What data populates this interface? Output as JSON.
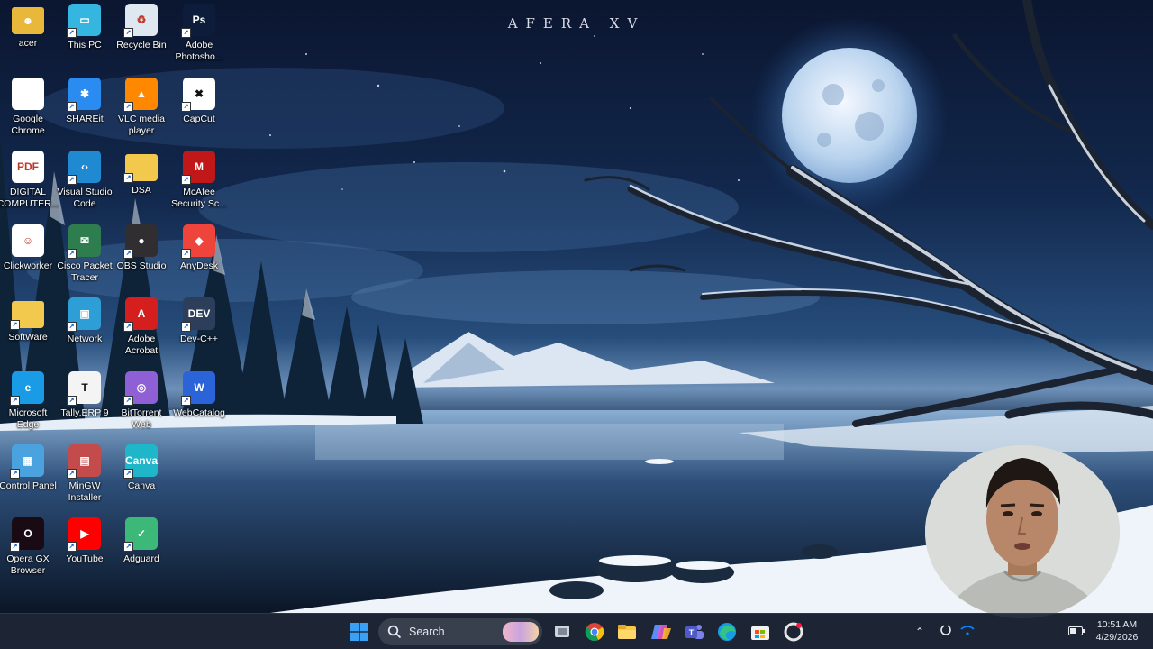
{
  "wallpaper": {
    "title": "AFERA XV"
  },
  "desktop_icons": [
    {
      "label": "acer",
      "icon": "user-folder-icon",
      "color": "#e9b83a"
    },
    {
      "label": "Google\nChrome",
      "icon": "chrome-icon",
      "color": "#ffffff"
    },
    {
      "label": "DIGITAL\nCOMPUTER...",
      "icon": "pdf-file-icon",
      "color": "#ffffff"
    },
    {
      "label": "Clickworker",
      "icon": "clickworker-icon",
      "color": "#ffffff"
    },
    {
      "label": "SoftWare",
      "icon": "folder-icon",
      "color": "#f2c94c"
    },
    {
      "label": "Microsoft\nEdge",
      "icon": "edge-icon",
      "color": "#1a9be6"
    },
    {
      "label": "Control Panel",
      "icon": "control-panel-icon",
      "color": "#4aa3df"
    },
    {
      "label": "Opera GX\nBrowser",
      "icon": "opera-gx-icon",
      "color": "#1a0a14"
    },
    {
      "label": "This PC",
      "icon": "computer-icon",
      "color": "#35b6e0"
    },
    {
      "label": "SHAREit",
      "icon": "shareit-icon",
      "color": "#2a8cf0"
    },
    {
      "label": "Visual Studio\nCode",
      "icon": "vscode-icon",
      "color": "#1f8ad2"
    },
    {
      "label": "Cisco Packet\nTracer",
      "icon": "cisco-packet-tracer-icon",
      "color": "#2e7d4f"
    },
    {
      "label": "Network",
      "icon": "network-icon",
      "color": "#2e9fd6"
    },
    {
      "label": "Tally.ERP 9",
      "icon": "tally-icon",
      "color": "#f4f4f4"
    },
    {
      "label": "MinGW\nInstaller",
      "icon": "mingw-installer-icon",
      "color": "#c44b4b"
    },
    {
      "label": "YouTube",
      "icon": "youtube-icon",
      "color": "#ff0000"
    },
    {
      "label": "Recycle Bin",
      "icon": "recycle-bin-icon",
      "color": "#dfe8f0"
    },
    {
      "label": "VLC media\nplayer",
      "icon": "vlc-icon",
      "color": "#ff8800"
    },
    {
      "label": "DSA",
      "icon": "folder-icon",
      "color": "#f2c94c"
    },
    {
      "label": "OBS Studio",
      "icon": "obs-icon",
      "color": "#302e31"
    },
    {
      "label": "Adobe\nAcrobat",
      "icon": "adobe-acrobat-icon",
      "color": "#d51e1e"
    },
    {
      "label": "BitTorrent\nWeb",
      "icon": "bittorrent-icon",
      "color": "#8f5fd6"
    },
    {
      "label": "Canva",
      "icon": "canva-icon",
      "color": "#1fb6c9"
    },
    {
      "label": "Adguard",
      "icon": "adguard-icon",
      "color": "#3cb878"
    },
    {
      "label": "Adobe\nPhotosho...",
      "icon": "photoshop-icon",
      "color": "#0c1c3a"
    },
    {
      "label": "CapCut",
      "icon": "capcut-icon",
      "color": "#ffffff"
    },
    {
      "label": "McAfee\nSecurity Sc...",
      "icon": "mcafee-icon",
      "color": "#c01818"
    },
    {
      "label": "AnyDesk",
      "icon": "anydesk-icon",
      "color": "#ef443b"
    },
    {
      "label": "Dev-C++",
      "icon": "dev-cpp-icon",
      "color": "#2c3e5a"
    },
    {
      "label": "WebCatalog",
      "icon": "webcatalog-icon",
      "color": "#2b63d9"
    }
  ],
  "taskbar": {
    "search_placeholder": "Search",
    "apps": [
      {
        "icon": "windows-start-icon"
      },
      {
        "icon": "task-view-icon"
      },
      {
        "icon": "chrome-icon"
      },
      {
        "icon": "file-explorer-icon"
      },
      {
        "icon": "copilot-icon"
      },
      {
        "icon": "teams-icon"
      },
      {
        "icon": "edge-icon"
      },
      {
        "icon": "microsoft-store-icon"
      },
      {
        "icon": "opera-gx-icon"
      }
    ],
    "clock": {
      "time": "10:51 AM",
      "date": "4/29/2026"
    }
  },
  "colors": {
    "taskbar": "#1e2636",
    "accent": "#0a84ff"
  }
}
